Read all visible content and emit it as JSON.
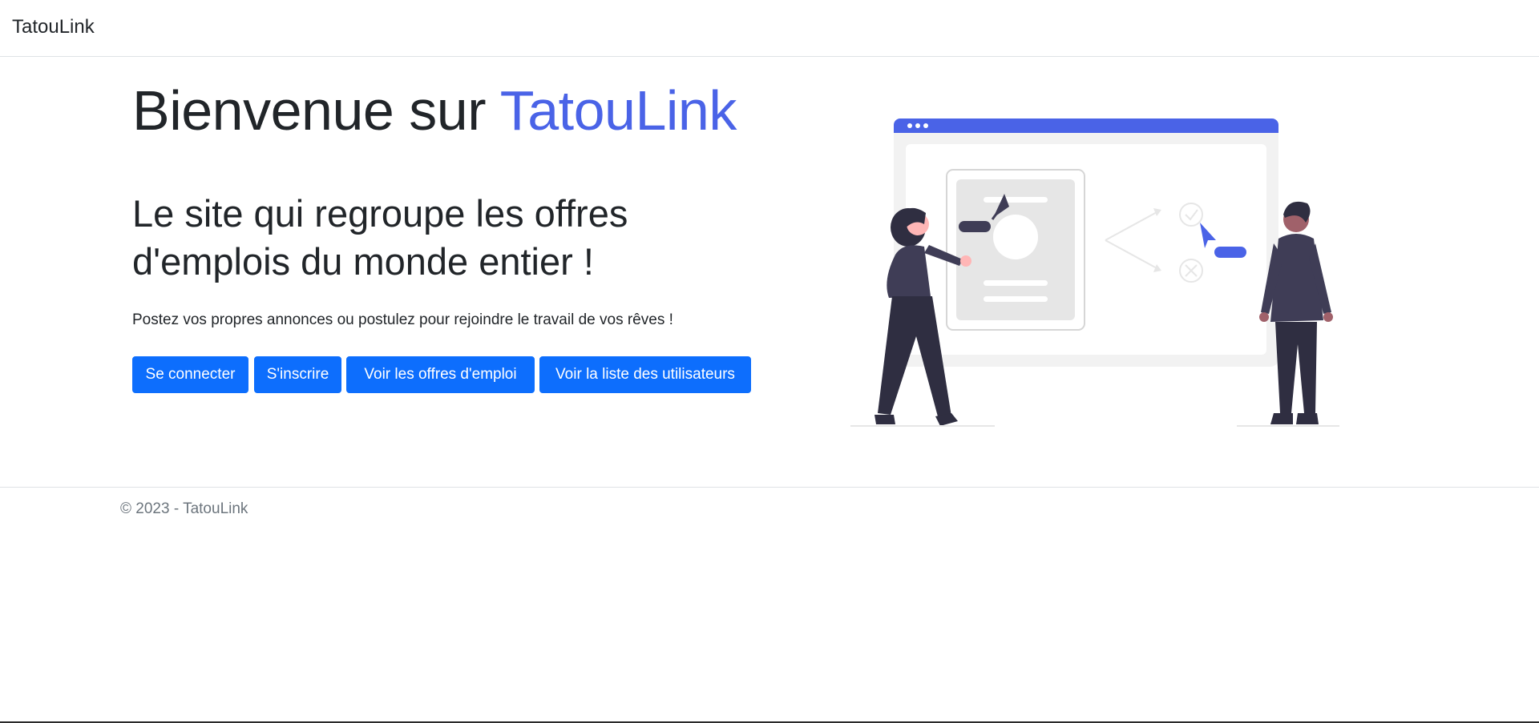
{
  "navbar": {
    "brand": "TatouLink"
  },
  "hero": {
    "title_prefix": "Bienvenue sur ",
    "title_accent": "TatouLink",
    "subtitle_line1": "Le site qui regroupe les offres",
    "subtitle_line2": "d'emplois du monde entier !",
    "lead": "Postez vos propres annonces ou postulez pour rejoindre le travail de vos rêves !"
  },
  "buttons": {
    "login": "Se connecter",
    "register": "S'inscrire",
    "job_offers": "Voir les offres d'emploi",
    "users_list": "Voir la liste des utilisateurs"
  },
  "footer": {
    "copyright": "© 2023 - TatouLink"
  },
  "colors": {
    "accent": "#4a63e7",
    "button": "#0d6efd",
    "text": "#212529",
    "muted": "#6c757d",
    "figure_dark": "#2f2e41",
    "illustration_gray": "#f2f2f2"
  },
  "illustration": {
    "icon": "job-search-illustration"
  }
}
